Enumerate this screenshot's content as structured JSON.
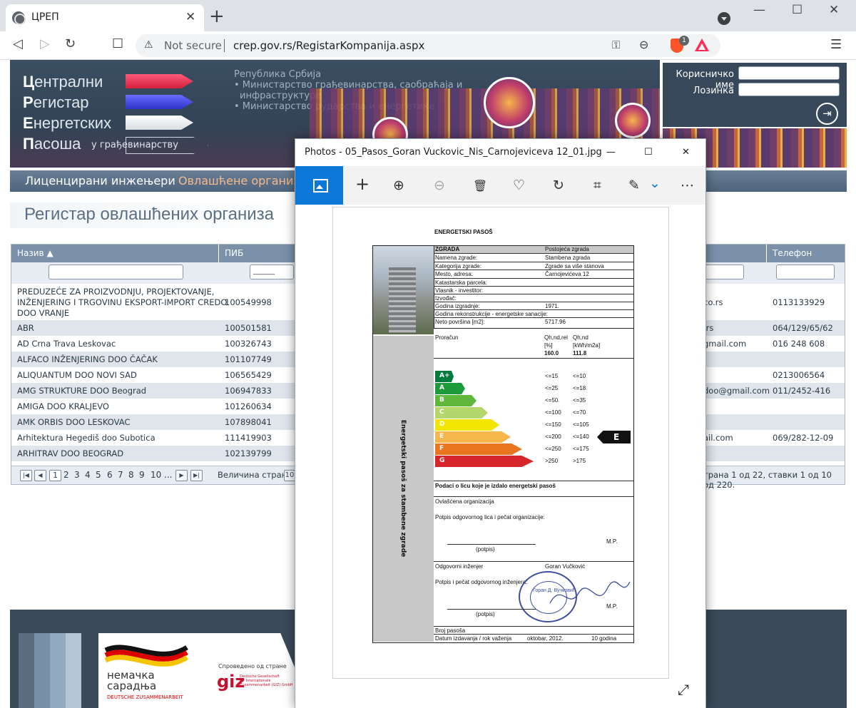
{
  "browser": {
    "tab_title": "ЦРЕП",
    "tab_close": "✕",
    "new_tab": "+",
    "window_controls": [
      "—",
      "☐",
      "✕"
    ],
    "nav_icons": [
      "back-icon",
      "forward-icon",
      "reload-icon",
      "bookmark-icon"
    ],
    "nav_glyphs": [
      "◁",
      "▷",
      "↻",
      "☐"
    ],
    "security_icon": "⚠",
    "security_label": "Not secure",
    "url": "crep.gov.rs/RegistarKompanija.aspx",
    "key_icon": "⚿",
    "zoom_icon": "⊖",
    "brave_badge": "1",
    "menu_icon": "☰"
  },
  "site": {
    "logo_lines": [
      {
        "initial": "Ц",
        "rest": "ентрални"
      },
      {
        "initial": "Р",
        "rest": "егистар"
      },
      {
        "initial": "Е",
        "rest": "нергетских"
      },
      {
        "initial": "П",
        "rest": "асоша"
      }
    ],
    "logo_sub": "у грађевинарству",
    "gov_lines": [
      "Република Србија",
      "• Министарство грађевинарства, саобраћаја и",
      "инфраструктуре",
      "• Министарство рударства и енергетике"
    ],
    "login": {
      "username_label": "Корисничко име",
      "password_label": "Лозинка",
      "login_icon": "⇥"
    },
    "nav": [
      {
        "label": "Лиценцирани инжењери",
        "color": "#ffffff"
      },
      {
        "label": "Овлашћене организа",
        "color": "#f5b98c"
      }
    ],
    "page_title": "Регистар овлашћених организа",
    "colors": {
      "accent": "#0b78d7",
      "header": "#324456",
      "grid_header": "#7a91a9"
    }
  },
  "grid": {
    "headers": [
      {
        "label": "Назив ▲"
      },
      {
        "label": "ПИБ"
      },
      {
        "label": "Телефон"
      }
    ],
    "rows": [
      {
        "name": [
          "PREDUZEĆE ZA PROIZVODNJU, PROJEKTOVANJE,",
          "INŽENJERING I TRGOVINU EKSPORT-IMPORT CREDO",
          "DOO VRANJE"
        ],
        "pib": "100549998",
        "email": "co.rs",
        "phone": "0113133929"
      },
      {
        "name": [
          "ABR"
        ],
        "pib": "100501581",
        "email": ".rs",
        "phone": "064/129/65/62"
      },
      {
        "name": [
          "AD Crna Trava Leskovac"
        ],
        "pib": "100326743",
        "email": "gmail.com",
        "phone": "016 248 608"
      },
      {
        "name": [
          "ALFACO INŽENJERING DOO ČAČAK"
        ],
        "pib": "101107749",
        "email": "",
        "phone": ""
      },
      {
        "name": [
          "ALIQUANTUM DOO NOVI SAD"
        ],
        "pib": "106565429",
        "email": "",
        "phone": "0213006564"
      },
      {
        "name": [
          "AMG STRUKTURE DOO Beograd"
        ],
        "pib": "106947833",
        "email": "doo@gmail.com",
        "phone": "011/2452-416"
      },
      {
        "name": [
          "AMIGA DOO KRALJEVO"
        ],
        "pib": "101260634",
        "email": "",
        "phone": ""
      },
      {
        "name": [
          "AMK ORBIS DOO LESKOVAC"
        ],
        "pib": "107898041",
        "email": "",
        "phone": ""
      },
      {
        "name": [
          "Arhitektura Hegediš doo Subotica"
        ],
        "pib": "111419903",
        "email": "ail.com",
        "phone": "069/282-12-09"
      },
      {
        "name": [
          "ARHITRAV DOO BEOGRAD"
        ],
        "pib": "102139799",
        "email": "",
        "phone": ""
      }
    ],
    "pager": {
      "first": "|◀",
      "prev": "◀",
      "pages": [
        "1",
        "2",
        "3",
        "4",
        "5",
        "6",
        "7",
        "8",
        "9",
        "10",
        "..."
      ],
      "next": "▶",
      "last": "▶|",
      "page_size_label": "Величина стране:",
      "page_size_value": "10",
      "summary": "трана 1 од 22, ставки 1 од 10 од 220."
    },
    "filter_placeholder_pib": "______"
  },
  "footer": {
    "stripe_colors": [
      "#5a6d80",
      "#7890a8",
      "#93aac0",
      "#b4c6d6"
    ],
    "partner_name": "немачка\nсарадња",
    "partner_sub": "DEUTSCHE ZUSAMMENARBEIT",
    "implemented_by": "Спроведено од стране",
    "giz": "giz",
    "giz_sub": "Deutsche Gesellschaft\nfür Internationale\nZusammenarbeit (GIZ) GmbH"
  },
  "photos": {
    "title": "Photos - 05_Pasos_Goran Vuckovic_Nis_Carnojeviceva 12_01.jpg",
    "window_controls": [
      "—",
      "☐",
      "✕"
    ],
    "tools": [
      {
        "name": "view-image-icon",
        "glyph": ""
      },
      {
        "name": "add-icon",
        "glyph": "+"
      },
      {
        "name": "zoom-in-icon",
        "glyph": "⊕"
      },
      {
        "name": "zoom-out-icon",
        "glyph": "⊖"
      },
      {
        "name": "delete-icon",
        "glyph": "🗑"
      },
      {
        "name": "favorite-icon",
        "glyph": "♡"
      },
      {
        "name": "rotate-icon",
        "glyph": "↻"
      },
      {
        "name": "crop-icon",
        "glyph": "⌗"
      },
      {
        "name": "edit-icon",
        "glyph": "✎"
      },
      {
        "name": "dropdown-chevron-icon",
        "glyph": "⌄"
      },
      {
        "name": "more-icon",
        "glyph": "⋯"
      }
    ],
    "expand_icon": "⤢"
  },
  "document": {
    "heading": "ENERGETSKI PASOŠ",
    "building_table": [
      [
        "ZGRADA",
        "Postojeća zgrada"
      ],
      [
        "Namena zgrade:",
        "Stambena zgrada"
      ],
      [
        "Kategorija zgrade:",
        "Zgrade sa više stanova"
      ],
      [
        "Mesto, adresa:",
        "Čarnojevićeva 12"
      ],
      [
        "Katastarska parcela:",
        ""
      ],
      [
        "Vlasnik - investitor:",
        ""
      ],
      [
        "Izvođač:",
        ""
      ],
      [
        "Godina izgradnje:",
        "1971."
      ],
      [
        "Godina rekonstrukcije - energetske sanacije:",
        ""
      ],
      [
        "Neto površina [m2]:",
        "5717.96"
      ]
    ],
    "calc_label": "Proračun",
    "calc_head1": [
      "Qh,nd,rel",
      "[%]",
      "160.0"
    ],
    "calc_head2": [
      "Qh,nd",
      "[kWh/m2a]",
      "111.8"
    ],
    "side_label": "Energetski pasoš za stambene zgrade",
    "classes": [
      {
        "label": "A+",
        "color": "#007a3d",
        "rel": "<=15",
        "abs": "<=10"
      },
      {
        "label": "A",
        "color": "#1d9a3a",
        "rel": "<=25",
        "abs": "<=18"
      },
      {
        "label": "B",
        "color": "#5fb73c",
        "rel": "<=50",
        "abs": "<=35"
      },
      {
        "label": "C",
        "color": "#b4d66b",
        "rel": "<=100",
        "abs": "<=70"
      },
      {
        "label": "D",
        "color": "#f2e600",
        "rel": "<=150",
        "abs": "<=105"
      },
      {
        "label": "E",
        "color": "#f6b64c",
        "rel": "<=200",
        "abs": "<=140"
      },
      {
        "label": "F",
        "color": "#e9751f",
        "rel": "<=250",
        "abs": "<=175"
      },
      {
        "label": "G",
        "color": "#d7262b",
        "rel": ">250",
        "abs": ">175"
      }
    ],
    "indicator": "E",
    "issuer_title": "Podaci o licu koje je izdalo energetski pasoš",
    "org_label": "Ovlašćena organizacija",
    "org_sign_label": "Potpis odgovornog lica i pečat organizacije:",
    "potpis": "(potpis)",
    "mp": "M.P.",
    "engineer_label": "Odgovorni inženjer",
    "engineer_name": "Goran Vučković",
    "eng_sign_label": "Potpis i pečat odgovornog inženjera:",
    "stamp_text": "Горан Д. Вучковић",
    "number_label": "Broj pasoša",
    "date_label": "Datum izdavanja / rok važenja",
    "date_value": "oktobar, 2012.",
    "validity": "10 godina"
  }
}
